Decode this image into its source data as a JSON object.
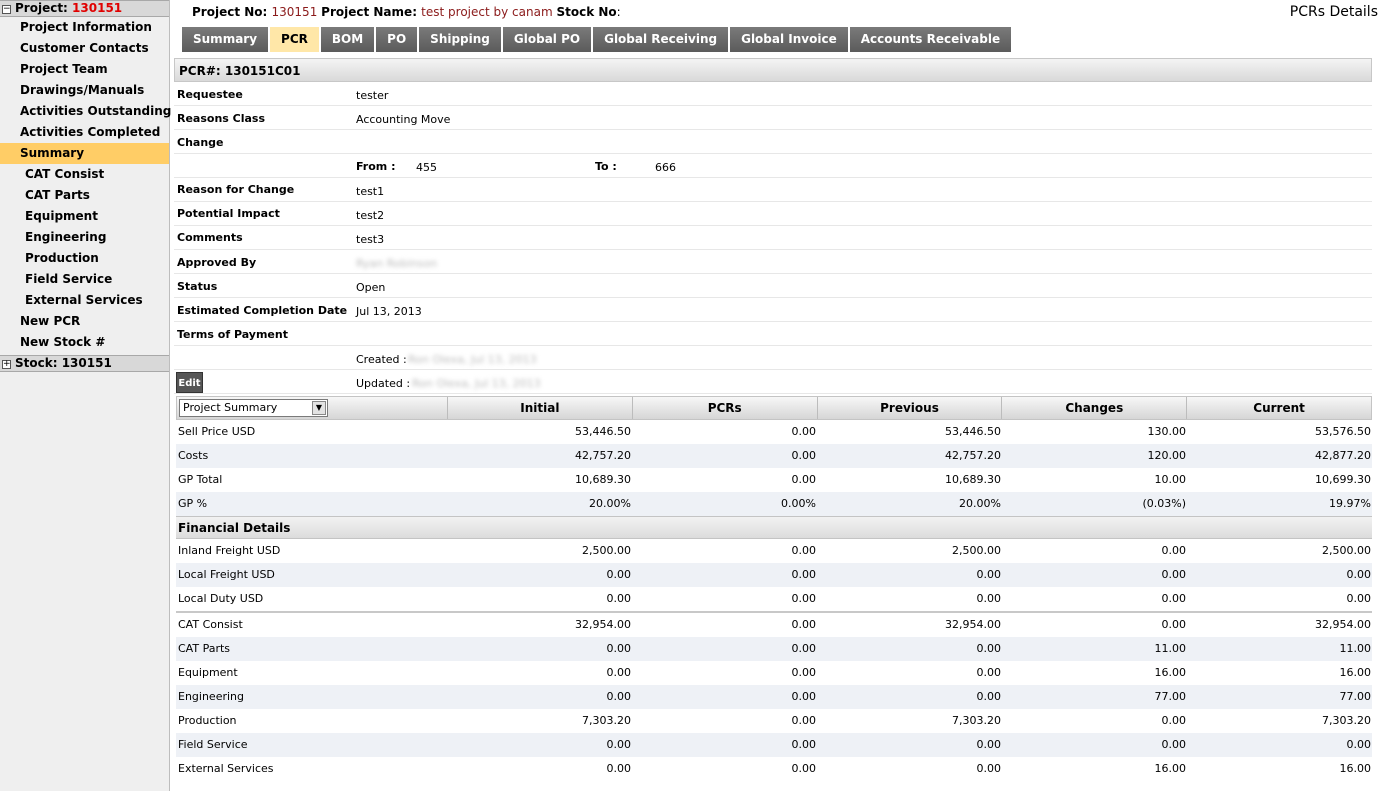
{
  "sidebar": {
    "project_label": "Project:",
    "project_number": "130151",
    "items": [
      {
        "label": "Project Information"
      },
      {
        "label": "Customer Contacts"
      },
      {
        "label": "Project Team"
      },
      {
        "label": "Drawings/Manuals"
      },
      {
        "label": "Activities Outstanding"
      },
      {
        "label": "Activities Completed"
      },
      {
        "label": "Summary"
      },
      {
        "label": "CAT Consist"
      },
      {
        "label": "CAT Parts"
      },
      {
        "label": "Equipment"
      },
      {
        "label": "Engineering"
      },
      {
        "label": "Production"
      },
      {
        "label": "Field Service"
      },
      {
        "label": "External Services"
      },
      {
        "label": "New PCR"
      },
      {
        "label": "New Stock #"
      }
    ],
    "stock_label": "Stock: 130151"
  },
  "header": {
    "project_no_label": "Project No",
    "project_no": "130151",
    "project_name_label": "Project Name",
    "project_name": "test project by canam",
    "stock_no_label": "Stock No",
    "page_title": "PCRs Details"
  },
  "tabs": [
    "Summary",
    "PCR",
    "BOM",
    "PO",
    "Shipping",
    "Global PO",
    "Global Receiving",
    "Global Invoice",
    "Accounts Receivable"
  ],
  "pcr": {
    "heading": "PCR#: 130151C01",
    "requestee_label": "Requestee",
    "requestee": "tester",
    "reasons_class_label": "Reasons Class",
    "reasons_class": "Accounting Move",
    "change_label": "Change",
    "from_label": "From :",
    "from_value": "455",
    "to_label": "To :",
    "to_value": "666",
    "reason_label": "Reason for Change",
    "reason": "test1",
    "impact_label": "Potential Impact",
    "impact": "test2",
    "comments_label": "Comments",
    "comments": "test3",
    "approved_label": "Approved By",
    "approved_by": "Ryan Robinson",
    "status_label": "Status",
    "status": "Open",
    "ecd_label": "Estimated Completion Date",
    "ecd": "Jul 13, 2013",
    "terms_label": "Terms of Payment",
    "created_label": "Created :",
    "created_value": "Ron Olexa, Jul 13, 2013",
    "updated_label": "Updated :",
    "updated_value": "Ron Olexa, Jul 13, 2013",
    "edit_label": "Edit"
  },
  "table": {
    "select_value": "Project Summary",
    "columns": [
      "Initial",
      "PCRs",
      "Previous",
      "Changes",
      "Current"
    ],
    "summary_rows": [
      {
        "label": "Sell Price USD",
        "values": [
          "53,446.50",
          "0.00",
          "53,446.50",
          "130.00",
          "53,576.50"
        ]
      },
      {
        "label": "Costs",
        "values": [
          "42,757.20",
          "0.00",
          "42,757.20",
          "120.00",
          "42,877.20"
        ]
      },
      {
        "label": "GP Total",
        "values": [
          "10,689.30",
          "0.00",
          "10,689.30",
          "10.00",
          "10,699.30"
        ]
      },
      {
        "label": "GP %",
        "values": [
          "20.00%",
          "0.00%",
          "20.00%",
          "(0.03%)",
          "19.97%"
        ]
      }
    ],
    "financial_heading": "Financial Details",
    "freight_rows": [
      {
        "label": "Inland Freight USD",
        "values": [
          "2,500.00",
          "0.00",
          "2,500.00",
          "0.00",
          "2,500.00"
        ]
      },
      {
        "label": "Local Freight USD",
        "values": [
          "0.00",
          "0.00",
          "0.00",
          "0.00",
          "0.00"
        ]
      },
      {
        "label": "Local Duty USD",
        "values": [
          "0.00",
          "0.00",
          "0.00",
          "0.00",
          "0.00"
        ]
      }
    ],
    "category_rows": [
      {
        "label": "CAT Consist",
        "values": [
          "32,954.00",
          "0.00",
          "32,954.00",
          "0.00",
          "32,954.00"
        ]
      },
      {
        "label": "CAT Parts",
        "values": [
          "0.00",
          "0.00",
          "0.00",
          "11.00",
          "11.00"
        ]
      },
      {
        "label": "Equipment",
        "values": [
          "0.00",
          "0.00",
          "0.00",
          "16.00",
          "16.00"
        ]
      },
      {
        "label": "Engineering",
        "values": [
          "0.00",
          "0.00",
          "0.00",
          "77.00",
          "77.00"
        ]
      },
      {
        "label": "Production",
        "values": [
          "7,303.20",
          "0.00",
          "7,303.20",
          "0.00",
          "7,303.20"
        ]
      },
      {
        "label": "Field Service",
        "values": [
          "0.00",
          "0.00",
          "0.00",
          "0.00",
          "0.00"
        ]
      },
      {
        "label": "External Services",
        "values": [
          "0.00",
          "0.00",
          "0.00",
          "16.00",
          "16.00"
        ]
      }
    ]
  }
}
